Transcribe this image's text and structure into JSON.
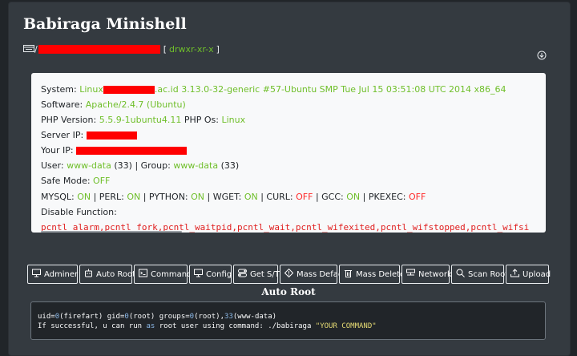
{
  "title": "Babiraga Minishell",
  "path": {
    "slash": "/",
    "open_bracket": "[",
    "permissions": "drwxr-xr-x",
    "close_bracket": "]"
  },
  "info": {
    "system_label": "System:",
    "system_os": "Linux",
    "system_rest": ".ac.id 3.13.0-32-generic #57-Ubuntu SMP Tue Jul 15 03:51:08 UTC 2014 x86_64",
    "software_label": "Software:",
    "software_value": "Apache/2.4.7 (Ubuntu)",
    "php_label": "PHP Version:",
    "php_value": "5.5.9-1ubuntu4.11",
    "phpos_label": "PHP Os:",
    "phpos_value": "Linux",
    "server_ip_label": "Server IP:",
    "your_ip_label": "Your IP:",
    "user_label": "User:",
    "user_value": "www-data",
    "user_id": "(33)",
    "group_label": "| Group:",
    "group_value": "www-data",
    "group_id": "(33)",
    "safe_mode_label": "Safe Mode:",
    "safe_mode_value": "OFF",
    "mysql_label": "MYSQL:",
    "mysql_value": "ON",
    "perl_label": "| PERL:",
    "perl_value": "ON",
    "python_label": "| PYTHON:",
    "python_value": "ON",
    "wget_label": "| WGET:",
    "wget_value": "ON",
    "curl_label": "| CURL:",
    "curl_value": "OFF",
    "gcc_label": "| GCC:",
    "gcc_value": "ON",
    "pkexec_label": "| PKEXEC:",
    "pkexec_value": "OFF",
    "disable_label": "Disable Function:",
    "disable_value": "pcntl_alarm,pcntl_fork,pcntl_waitpid,pcntl_wait,pcntl_wifexited,pcntl_wifstopped,pcntl_wifsi"
  },
  "toolbar": [
    {
      "label": "Adminer",
      "icon": "monitor-icon"
    },
    {
      "label": "Auto Root",
      "icon": "robot-icon"
    },
    {
      "label": "Command",
      "icon": "terminal-icon"
    },
    {
      "label": "Config",
      "icon": "monitor-icon"
    },
    {
      "label": "Get S/T",
      "icon": "toggle-icon"
    },
    {
      "label": "Mass Deface",
      "icon": "diamond-icon"
    },
    {
      "label": "Mass Delete",
      "icon": "trash-icon"
    },
    {
      "label": "Network",
      "icon": "network-icon"
    },
    {
      "label": "Scan Root",
      "icon": "search-icon"
    },
    {
      "label": "Upload",
      "icon": "upload-icon"
    }
  ],
  "section_title": "Auto Root",
  "console": {
    "uid_a": "uid=",
    "uid_num": "0",
    "uid_b": "(firefart) gid=",
    "gid_num": "0",
    "gid_b": "(root) groups=",
    "groups_num": "0",
    "groups_b": "(root),",
    "groups_num2": "33",
    "groups_c": "(www-data)",
    "line2_a": "If successful, u can run ",
    "line2_kw": "as",
    "line2_b": " root user using command: ./babiraga ",
    "line2_str": "\"YOUR COMMAND\""
  },
  "colors": {
    "accent_green": "#6fbf2a",
    "off_red": "#ff2a2a",
    "redaction": "#ff0000"
  }
}
